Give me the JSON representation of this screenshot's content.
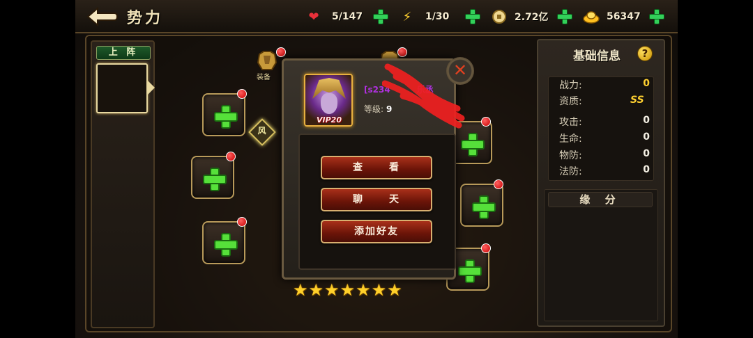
{
  "header": {
    "title": "势力",
    "resources": [
      {
        "icon": "heart-icon",
        "value": "5/147",
        "color": "#e8303a"
      },
      {
        "icon": "lightning-icon",
        "value": "1/30",
        "color": "#ffd030"
      },
      {
        "icon": "coin-icon",
        "value": "2.72亿",
        "color": "#f0d890"
      },
      {
        "icon": "gold-ingot-icon",
        "value": "56347",
        "color": "#ffc020"
      }
    ]
  },
  "left": {
    "tab_label": "上 阵"
  },
  "equipment": {
    "top_label": "装备",
    "gem_label": "风"
  },
  "stars": {
    "count": 7
  },
  "popup": {
    "player_name": "[s234",
    "player_name_tail": "乐丞",
    "level_label": "等级:",
    "level_value": "9",
    "vip": "VIP20",
    "close": "✕",
    "buttons": [
      {
        "label_a": "查",
        "label_b": "看"
      },
      {
        "label_a": "聊",
        "label_b": "天"
      },
      {
        "label": "添加好友"
      }
    ]
  },
  "info": {
    "title": "基础信息",
    "help": "?",
    "stats": [
      {
        "key": "战力:",
        "value": "0"
      },
      {
        "key": "资质:",
        "value": "SS"
      },
      {
        "key": "攻击:",
        "value": "0"
      },
      {
        "key": "生命:",
        "value": "0"
      },
      {
        "key": "物防:",
        "value": "0"
      },
      {
        "key": "法防:",
        "value": "0"
      }
    ],
    "yuanfen_title": "缘 分"
  },
  "colors": {
    "accent_gold": "#d8b070",
    "button_red": "#8a1e0e",
    "plus_green": "#33d05a",
    "name_purple": "#b030e0"
  }
}
